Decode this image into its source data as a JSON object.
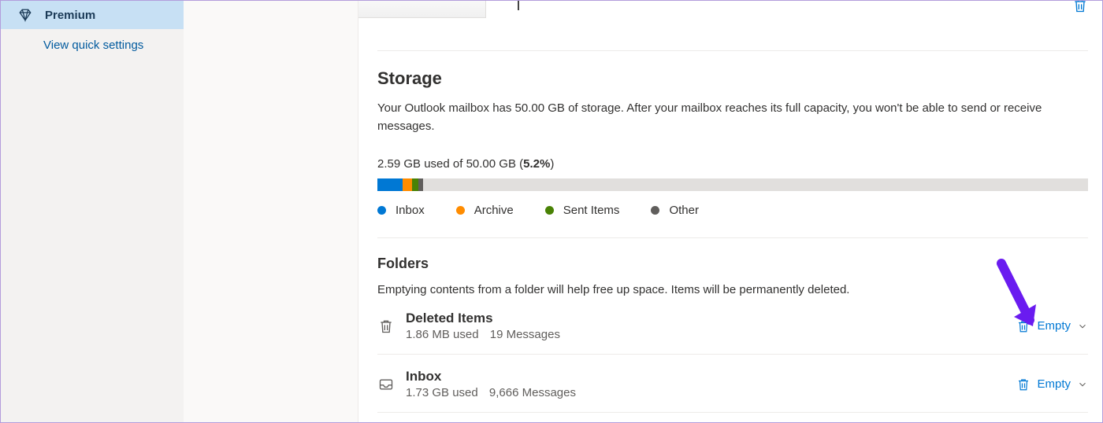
{
  "sidebar": {
    "premium_label": "Premium",
    "quick_settings_label": "View quick settings"
  },
  "storage": {
    "heading": "Storage",
    "description": "Your Outlook mailbox has 50.00 GB of storage. After your mailbox reaches its full capacity, you won't be able to send or receive messages.",
    "usage_prefix": "2.59 GB used of 50.00 GB (",
    "usage_pct": "5.2%",
    "usage_suffix": ")",
    "legend": {
      "inbox": "Inbox",
      "archive": "Archive",
      "sent": "Sent Items",
      "other": "Other"
    }
  },
  "folders_section": {
    "heading": "Folders",
    "description": "Emptying contents from a folder will help free up space. Items will be permanently deleted.",
    "empty_label": "Empty",
    "items": [
      {
        "name": "Deleted Items",
        "used": "1.86 MB used",
        "messages": "19 Messages",
        "icon": "trash"
      },
      {
        "name": "Inbox",
        "used": "1.73 GB used",
        "messages": "9,666 Messages",
        "icon": "inbox"
      }
    ]
  },
  "colors": {
    "accent": "#0078d4",
    "annotation": "#6a1bf0"
  }
}
